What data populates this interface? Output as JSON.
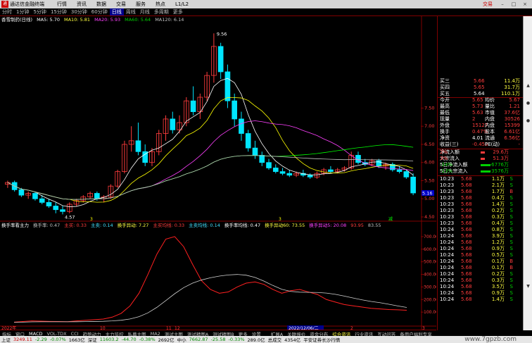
{
  "app": {
    "title": "通达信金融终端",
    "trade_btn": "交易"
  },
  "menus": [
    "行情",
    "资讯",
    "数据",
    "交易",
    "服务",
    "热点",
    "L1/L2"
  ],
  "periods": [
    "分时",
    "1分钟",
    "5分钟",
    "15分钟",
    "30分钟",
    "60分钟",
    "日线",
    "周线",
    "月线",
    "多周期",
    "更多"
  ],
  "active_period": "日线",
  "main_legend": {
    "stock": "香雪制药(日线)",
    "ma5": "MA5: 5.70",
    "ma10": "MA10: 5.81",
    "ma20": "MA20: 5.93",
    "ma60": "MA60: 5.64",
    "ma120": "MA120: 6.14"
  },
  "colors": {
    "up": "#ff3c3c",
    "down": "#00e5ff",
    "ma5": "#ffffff",
    "ma10": "#ffff00",
    "ma20": "#ff40ff",
    "ma60": "#00ff00",
    "ma120": "#c0c0c0",
    "grid": "#800000"
  },
  "annotations": {
    "high": "9.56",
    "low": "4.57"
  },
  "price_axis": [
    "7.50",
    "7.00",
    "6.50",
    "6.00",
    "5.50",
    "5.00",
    "4.50"
  ],
  "last_price_tag": "5.16",
  "sub_legend": {
    "name": "换手率看主力",
    "items": [
      "换手率: 0.47",
      "主买: 0.33",
      "主卖: 0.14",
      "换手异动: 7.27",
      "主买均线: 0.33",
      "主卖均线: 0.14",
      "换手率均线: 0.47",
      "换手异动60: 73.55",
      "换手异动5: 20.08",
      "93.95",
      "83.55"
    ]
  },
  "sub_axis": [
    "700.00",
    "600.00",
    "500.00",
    "400.00",
    "300.00",
    "200.00",
    "100.00"
  ],
  "date_axis": [
    "2022年",
    "10",
    "11",
    "12",
    "2022/12/06/二",
    "2",
    "3",
    "4"
  ],
  "markers": {
    "m1": "3",
    "m2": "3",
    "m3": "减"
  },
  "chart_data": {
    "type": "candlestick",
    "ylim": [
      4.5,
      9.8
    ],
    "candles": [
      [
        5.4,
        5.5,
        5.3,
        5.45
      ],
      [
        5.45,
        5.5,
        5.2,
        5.25
      ],
      [
        5.25,
        5.3,
        5.05,
        5.1
      ],
      [
        5.1,
        5.2,
        5.0,
        5.15
      ],
      [
        5.15,
        5.2,
        4.95,
        5.0
      ],
      [
        5.0,
        5.1,
        4.85,
        4.9
      ],
      [
        4.9,
        5.0,
        4.75,
        4.8
      ],
      [
        4.8,
        4.9,
        4.6,
        4.7
      ],
      [
        4.7,
        4.8,
        4.57,
        4.65
      ],
      [
        4.65,
        4.9,
        4.6,
        4.85
      ],
      [
        4.85,
        5.0,
        4.8,
        4.95
      ],
      [
        4.95,
        5.1,
        4.9,
        5.05
      ],
      [
        5.05,
        5.2,
        5.0,
        5.15
      ],
      [
        5.15,
        5.2,
        4.95,
        5.0
      ],
      [
        5.0,
        5.1,
        4.9,
        5.05
      ],
      [
        5.05,
        5.4,
        5.0,
        5.35
      ],
      [
        5.35,
        5.8,
        5.3,
        5.75
      ],
      [
        5.75,
        6.6,
        5.7,
        6.5
      ],
      [
        6.5,
        7.0,
        6.3,
        6.6
      ],
      [
        6.6,
        7.1,
        6.2,
        6.3
      ],
      [
        6.3,
        6.5,
        5.9,
        6.0
      ],
      [
        6.0,
        6.4,
        5.9,
        6.3
      ],
      [
        6.3,
        6.9,
        6.2,
        6.8
      ],
      [
        6.8,
        7.3,
        6.6,
        7.2
      ],
      [
        7.2,
        7.4,
        6.8,
        6.9
      ],
      [
        6.9,
        7.3,
        6.8,
        7.1
      ],
      [
        7.1,
        7.8,
        7.0,
        7.7
      ],
      [
        7.7,
        8.1,
        7.3,
        7.4
      ],
      [
        7.4,
        7.9,
        7.2,
        7.8
      ],
      [
        7.8,
        8.5,
        7.7,
        8.4
      ],
      [
        8.4,
        9.56,
        8.2,
        9.2
      ],
      [
        9.2,
        9.3,
        8.3,
        8.5
      ],
      [
        8.5,
        8.7,
        7.5,
        7.7
      ],
      [
        7.7,
        7.9,
        7.0,
        7.2
      ],
      [
        7.2,
        7.4,
        6.6,
        6.8
      ],
      [
        6.8,
        6.9,
        6.3,
        6.4
      ],
      [
        6.4,
        6.6,
        6.1,
        6.2
      ],
      [
        6.2,
        6.3,
        5.9,
        6.0
      ],
      [
        6.0,
        6.1,
        5.8,
        5.85
      ],
      [
        5.85,
        5.95,
        5.7,
        5.75
      ],
      [
        5.75,
        5.85,
        5.65,
        5.7
      ],
      [
        5.7,
        5.8,
        5.6,
        5.65
      ],
      [
        5.65,
        5.75,
        5.6,
        5.7
      ],
      [
        5.7,
        5.8,
        5.6,
        5.65
      ],
      [
        5.65,
        5.7,
        5.55,
        5.6
      ],
      [
        5.6,
        5.75,
        5.55,
        5.7
      ],
      [
        5.7,
        5.85,
        5.65,
        5.8
      ],
      [
        5.8,
        5.9,
        5.7,
        5.75
      ],
      [
        5.75,
        5.85,
        5.7,
        5.8
      ],
      [
        5.8,
        5.9,
        5.75,
        5.85
      ],
      [
        5.85,
        6.3,
        5.8,
        6.2
      ],
      [
        6.2,
        6.3,
        5.95,
        6.0
      ],
      [
        6.0,
        6.1,
        5.9,
        5.95
      ],
      [
        5.95,
        6.1,
        5.9,
        6.05
      ],
      [
        6.05,
        6.1,
        5.85,
        5.9
      ],
      [
        5.9,
        6.0,
        5.8,
        5.95
      ],
      [
        5.95,
        6.0,
        5.75,
        5.8
      ],
      [
        5.8,
        5.9,
        5.7,
        5.75
      ],
      [
        5.75,
        5.8,
        5.55,
        5.6
      ],
      [
        5.6,
        5.7,
        5.1,
        5.16
      ]
    ],
    "turnover": [
      20,
      25,
      30,
      28,
      26,
      25,
      24,
      30,
      35,
      40,
      45,
      60,
      90,
      150,
      250,
      400,
      560,
      680,
      700,
      620,
      480,
      350,
      280,
      250,
      260,
      300,
      330,
      340,
      320,
      280,
      250,
      270,
      280,
      260,
      240,
      200,
      180,
      160,
      150,
      140,
      130,
      125,
      120,
      118,
      115
    ]
  },
  "quote_panel": {
    "rows": [
      {
        "l": "买三",
        "v": "5.66",
        "a": "11.4万"
      },
      {
        "l": "买四",
        "v": "5.65",
        "a": "31.7万"
      },
      {
        "l": "买五",
        "v": "5.64",
        "a": "110.1万"
      },
      {
        "l": "今开",
        "v": "5.65",
        "l2": "均价",
        "v2": "5.67"
      },
      {
        "l": "最高",
        "v": "5.73",
        "l2": "量比",
        "v2": "1.21"
      },
      {
        "l": "最低",
        "v": "5.63",
        "l2": "市值",
        "v2": "37.6亿"
      },
      {
        "l": "现量",
        "v": "2",
        "l2": "内盘",
        "v2": "30526"
      },
      {
        "l": "外盘",
        "v": "15127",
        "l2": "内盘",
        "v2": "15399"
      },
      {
        "l": "换手",
        "v": "0.47%",
        "l2": "股本",
        "v2": "6.61亿"
      },
      {
        "l": "净资",
        "v": "4.01",
        "l2": "流通",
        "v2": "6.56亿"
      },
      {
        "l": "收益(三)",
        "v": "-0.450",
        "l2": "PE(动)",
        "v2": "-"
      }
    ],
    "flow": [
      {
        "l": "净流入额",
        "v": "29.6万",
        "p": "2%"
      },
      {
        "l": "大宗流入",
        "v": "51.3万",
        "p": "3%"
      },
      {
        "l": "5日净流入额",
        "v": "-6776万",
        "p": "-24%"
      },
      {
        "l": "5日大宗流入",
        "v": "-3576万",
        "p": "-13%"
      }
    ],
    "ticks": [
      [
        "10:23",
        "5.68",
        "1.1万",
        "S"
      ],
      [
        "10:23",
        "5.68",
        "2.1万",
        "S"
      ],
      [
        "10:23",
        "5.68",
        "1.7万",
        "B"
      ],
      [
        "10:23",
        "5.68",
        "0.4万",
        "S"
      ],
      [
        "10:23",
        "5.68",
        "1.4万",
        "S"
      ],
      [
        "10:23",
        "5.68",
        "0.2万",
        "S"
      ],
      [
        "10:23",
        "5.68",
        "0.3万",
        "S"
      ],
      [
        "10:23",
        "5.68",
        "0.4万",
        "S"
      ],
      [
        "10:24",
        "5.68",
        "0.8万",
        "S"
      ],
      [
        "10:24",
        "5.68",
        "3.9万",
        "S"
      ],
      [
        "10:24",
        "5.68",
        "1.2万",
        "S"
      ],
      [
        "10:24",
        "5.68",
        "0.9万",
        "S"
      ],
      [
        "10:24",
        "5.68",
        "0.5万",
        "S"
      ],
      [
        "10:24",
        "5.68",
        "0.1万",
        "B"
      ],
      [
        "10:24",
        "5.68",
        "0.1万",
        "B"
      ],
      [
        "10:24",
        "5.68",
        "0.2万",
        "S"
      ],
      [
        "10:24",
        "5.68",
        "0.3万",
        "S"
      ],
      [
        "10:24",
        "5.68",
        "3.5万",
        "S"
      ],
      [
        "10:24",
        "5.68",
        "0.9万",
        "S"
      ],
      [
        "10:24",
        "5.68",
        "1.4万",
        "S"
      ]
    ]
  },
  "indicator_tabs": [
    "指标",
    "窗口",
    "MACD",
    "VOL-TDX",
    "CCI",
    "趋势动力",
    "主力监控",
    "私募主图",
    "MA2",
    "测试主图",
    "测试精图A",
    "测试精图B",
    "更多",
    "设置"
  ],
  "bottom_tools": [
    "扩展A",
    "关联报价",
    "资金分布",
    "综合资讯",
    "行业资讯",
    "互动问答",
    "备用户福利专享"
  ],
  "footer": {
    "sh": {
      "n": "上证",
      "v": "3249.11",
      "c": "-2.29",
      "p": "-0.07%",
      "a": "1663亿"
    },
    "sz": {
      "n": "深证",
      "v": "11603.2",
      "c": "-44.70",
      "p": "-0.38%",
      "a": "2692亿"
    },
    "zx": {
      "n": "中小",
      "v": "7662.87",
      "c": "-25.58",
      "p": "-0.33%",
      "a": "289.0亿"
    },
    "zf": {
      "n": "总成交",
      "v": "4354亿"
    },
    "broker": "平安证券长沙行情",
    "website": "www.7gpzb.com"
  }
}
